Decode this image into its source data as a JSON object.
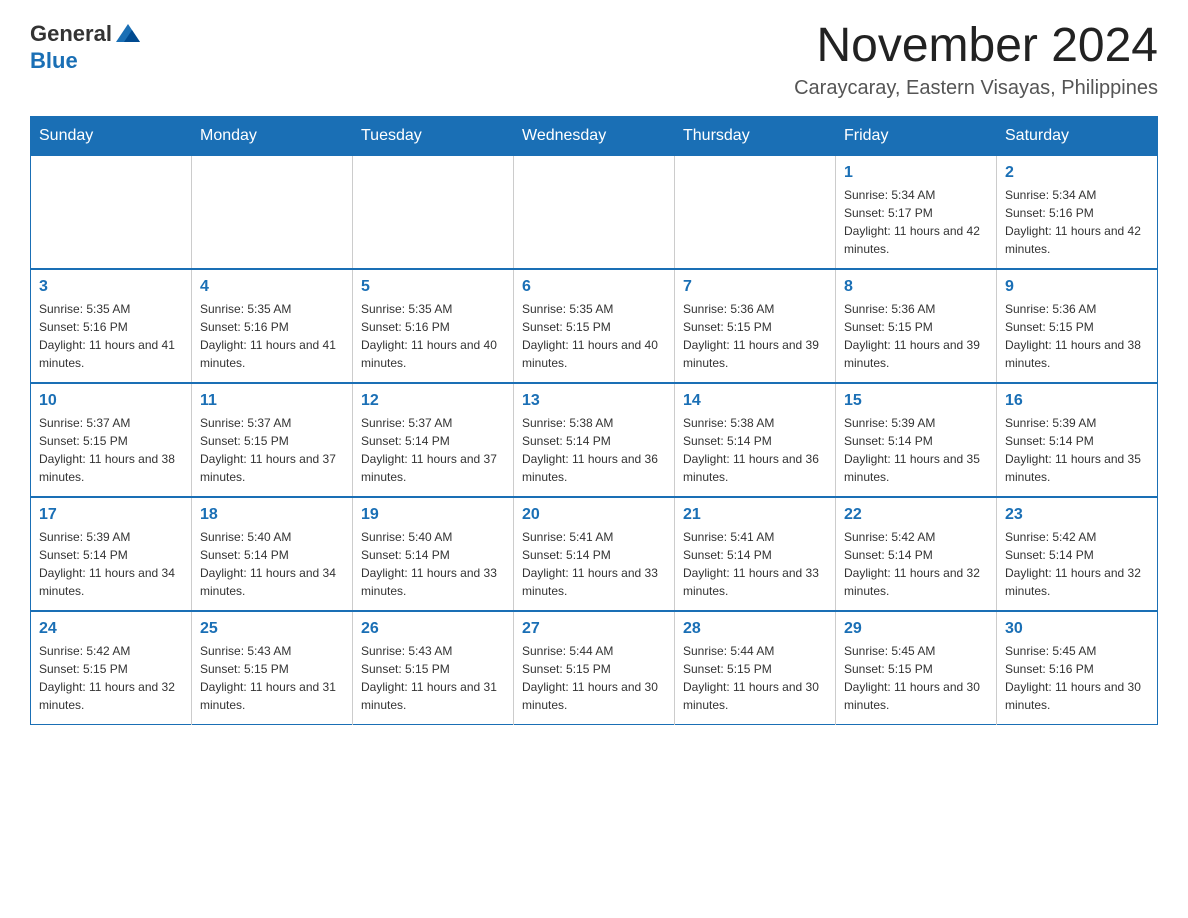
{
  "logo": {
    "general": "General",
    "blue": "Blue"
  },
  "title": "November 2024",
  "subtitle": "Caraycaray, Eastern Visayas, Philippines",
  "days_of_week": [
    "Sunday",
    "Monday",
    "Tuesday",
    "Wednesday",
    "Thursday",
    "Friday",
    "Saturday"
  ],
  "weeks": [
    [
      {
        "day": "",
        "info": ""
      },
      {
        "day": "",
        "info": ""
      },
      {
        "day": "",
        "info": ""
      },
      {
        "day": "",
        "info": ""
      },
      {
        "day": "",
        "info": ""
      },
      {
        "day": "1",
        "info": "Sunrise: 5:34 AM\nSunset: 5:17 PM\nDaylight: 11 hours and 42 minutes."
      },
      {
        "day": "2",
        "info": "Sunrise: 5:34 AM\nSunset: 5:16 PM\nDaylight: 11 hours and 42 minutes."
      }
    ],
    [
      {
        "day": "3",
        "info": "Sunrise: 5:35 AM\nSunset: 5:16 PM\nDaylight: 11 hours and 41 minutes."
      },
      {
        "day": "4",
        "info": "Sunrise: 5:35 AM\nSunset: 5:16 PM\nDaylight: 11 hours and 41 minutes."
      },
      {
        "day": "5",
        "info": "Sunrise: 5:35 AM\nSunset: 5:16 PM\nDaylight: 11 hours and 40 minutes."
      },
      {
        "day": "6",
        "info": "Sunrise: 5:35 AM\nSunset: 5:15 PM\nDaylight: 11 hours and 40 minutes."
      },
      {
        "day": "7",
        "info": "Sunrise: 5:36 AM\nSunset: 5:15 PM\nDaylight: 11 hours and 39 minutes."
      },
      {
        "day": "8",
        "info": "Sunrise: 5:36 AM\nSunset: 5:15 PM\nDaylight: 11 hours and 39 minutes."
      },
      {
        "day": "9",
        "info": "Sunrise: 5:36 AM\nSunset: 5:15 PM\nDaylight: 11 hours and 38 minutes."
      }
    ],
    [
      {
        "day": "10",
        "info": "Sunrise: 5:37 AM\nSunset: 5:15 PM\nDaylight: 11 hours and 38 minutes."
      },
      {
        "day": "11",
        "info": "Sunrise: 5:37 AM\nSunset: 5:15 PM\nDaylight: 11 hours and 37 minutes."
      },
      {
        "day": "12",
        "info": "Sunrise: 5:37 AM\nSunset: 5:14 PM\nDaylight: 11 hours and 37 minutes."
      },
      {
        "day": "13",
        "info": "Sunrise: 5:38 AM\nSunset: 5:14 PM\nDaylight: 11 hours and 36 minutes."
      },
      {
        "day": "14",
        "info": "Sunrise: 5:38 AM\nSunset: 5:14 PM\nDaylight: 11 hours and 36 minutes."
      },
      {
        "day": "15",
        "info": "Sunrise: 5:39 AM\nSunset: 5:14 PM\nDaylight: 11 hours and 35 minutes."
      },
      {
        "day": "16",
        "info": "Sunrise: 5:39 AM\nSunset: 5:14 PM\nDaylight: 11 hours and 35 minutes."
      }
    ],
    [
      {
        "day": "17",
        "info": "Sunrise: 5:39 AM\nSunset: 5:14 PM\nDaylight: 11 hours and 34 minutes."
      },
      {
        "day": "18",
        "info": "Sunrise: 5:40 AM\nSunset: 5:14 PM\nDaylight: 11 hours and 34 minutes."
      },
      {
        "day": "19",
        "info": "Sunrise: 5:40 AM\nSunset: 5:14 PM\nDaylight: 11 hours and 33 minutes."
      },
      {
        "day": "20",
        "info": "Sunrise: 5:41 AM\nSunset: 5:14 PM\nDaylight: 11 hours and 33 minutes."
      },
      {
        "day": "21",
        "info": "Sunrise: 5:41 AM\nSunset: 5:14 PM\nDaylight: 11 hours and 33 minutes."
      },
      {
        "day": "22",
        "info": "Sunrise: 5:42 AM\nSunset: 5:14 PM\nDaylight: 11 hours and 32 minutes."
      },
      {
        "day": "23",
        "info": "Sunrise: 5:42 AM\nSunset: 5:14 PM\nDaylight: 11 hours and 32 minutes."
      }
    ],
    [
      {
        "day": "24",
        "info": "Sunrise: 5:42 AM\nSunset: 5:15 PM\nDaylight: 11 hours and 32 minutes."
      },
      {
        "day": "25",
        "info": "Sunrise: 5:43 AM\nSunset: 5:15 PM\nDaylight: 11 hours and 31 minutes."
      },
      {
        "day": "26",
        "info": "Sunrise: 5:43 AM\nSunset: 5:15 PM\nDaylight: 11 hours and 31 minutes."
      },
      {
        "day": "27",
        "info": "Sunrise: 5:44 AM\nSunset: 5:15 PM\nDaylight: 11 hours and 30 minutes."
      },
      {
        "day": "28",
        "info": "Sunrise: 5:44 AM\nSunset: 5:15 PM\nDaylight: 11 hours and 30 minutes."
      },
      {
        "day": "29",
        "info": "Sunrise: 5:45 AM\nSunset: 5:15 PM\nDaylight: 11 hours and 30 minutes."
      },
      {
        "day": "30",
        "info": "Sunrise: 5:45 AM\nSunset: 5:16 PM\nDaylight: 11 hours and 30 minutes."
      }
    ]
  ]
}
